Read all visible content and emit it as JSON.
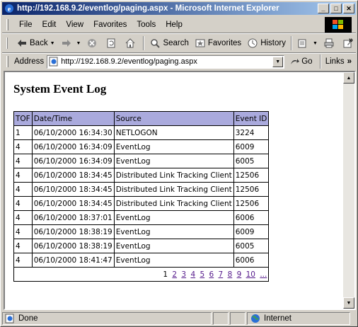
{
  "window": {
    "title": "http://192.168.9.2/eventlog/paging.aspx - Microsoft Internet Explorer",
    "minimize_glyph": "_",
    "maximize_glyph": "□",
    "close_glyph": "✕"
  },
  "menu": {
    "items": [
      {
        "label": "File"
      },
      {
        "label": "Edit"
      },
      {
        "label": "View"
      },
      {
        "label": "Favorites"
      },
      {
        "label": "Tools"
      },
      {
        "label": "Help"
      }
    ]
  },
  "toolbar": {
    "back_label": "Back",
    "search_label": "Search",
    "favorites_label": "Favorites",
    "history_label": "History",
    "overflow_glyph": "»"
  },
  "address": {
    "label": "Address",
    "url": "http://192.168.9.2/eventlog/paging.aspx",
    "go_label": "Go",
    "links_label": "Links",
    "links_glyph": "»"
  },
  "page": {
    "heading": "System Event Log",
    "table": {
      "columns": [
        "TOF",
        "Date/Time",
        "Source",
        "Event ID"
      ],
      "rows": [
        [
          "1",
          "06/10/2000 16:34:30",
          "NETLOGON",
          "3224"
        ],
        [
          "4",
          "06/10/2000 16:34:09",
          "EventLog",
          "6009"
        ],
        [
          "4",
          "06/10/2000 16:34:09",
          "EventLog",
          "6005"
        ],
        [
          "4",
          "06/10/2000 18:34:45",
          "Distributed Link Tracking Client",
          "12506"
        ],
        [
          "4",
          "06/10/2000 18:34:45",
          "Distributed Link Tracking Client",
          "12506"
        ],
        [
          "4",
          "06/10/2000 18:34:45",
          "Distributed Link Tracking Client",
          "12506"
        ],
        [
          "4",
          "06/10/2000 18:37:01",
          "EventLog",
          "6006"
        ],
        [
          "4",
          "06/10/2000 18:38:19",
          "EventLog",
          "6009"
        ],
        [
          "4",
          "06/10/2000 18:38:19",
          "EventLog",
          "6005"
        ],
        [
          "4",
          "06/10/2000 18:41:47",
          "EventLog",
          "6006"
        ]
      ]
    },
    "pager": {
      "current": "1",
      "links": [
        "2",
        "3",
        "4",
        "5",
        "6",
        "7",
        "8",
        "9",
        "10",
        "..."
      ]
    }
  },
  "status": {
    "text": "Done",
    "zone": "Internet"
  },
  "colors": {
    "header_bg": "#aaaadd",
    "link_visited": "#551a8b",
    "titlebar_start": "#0a246a",
    "titlebar_end": "#a6caf0"
  }
}
